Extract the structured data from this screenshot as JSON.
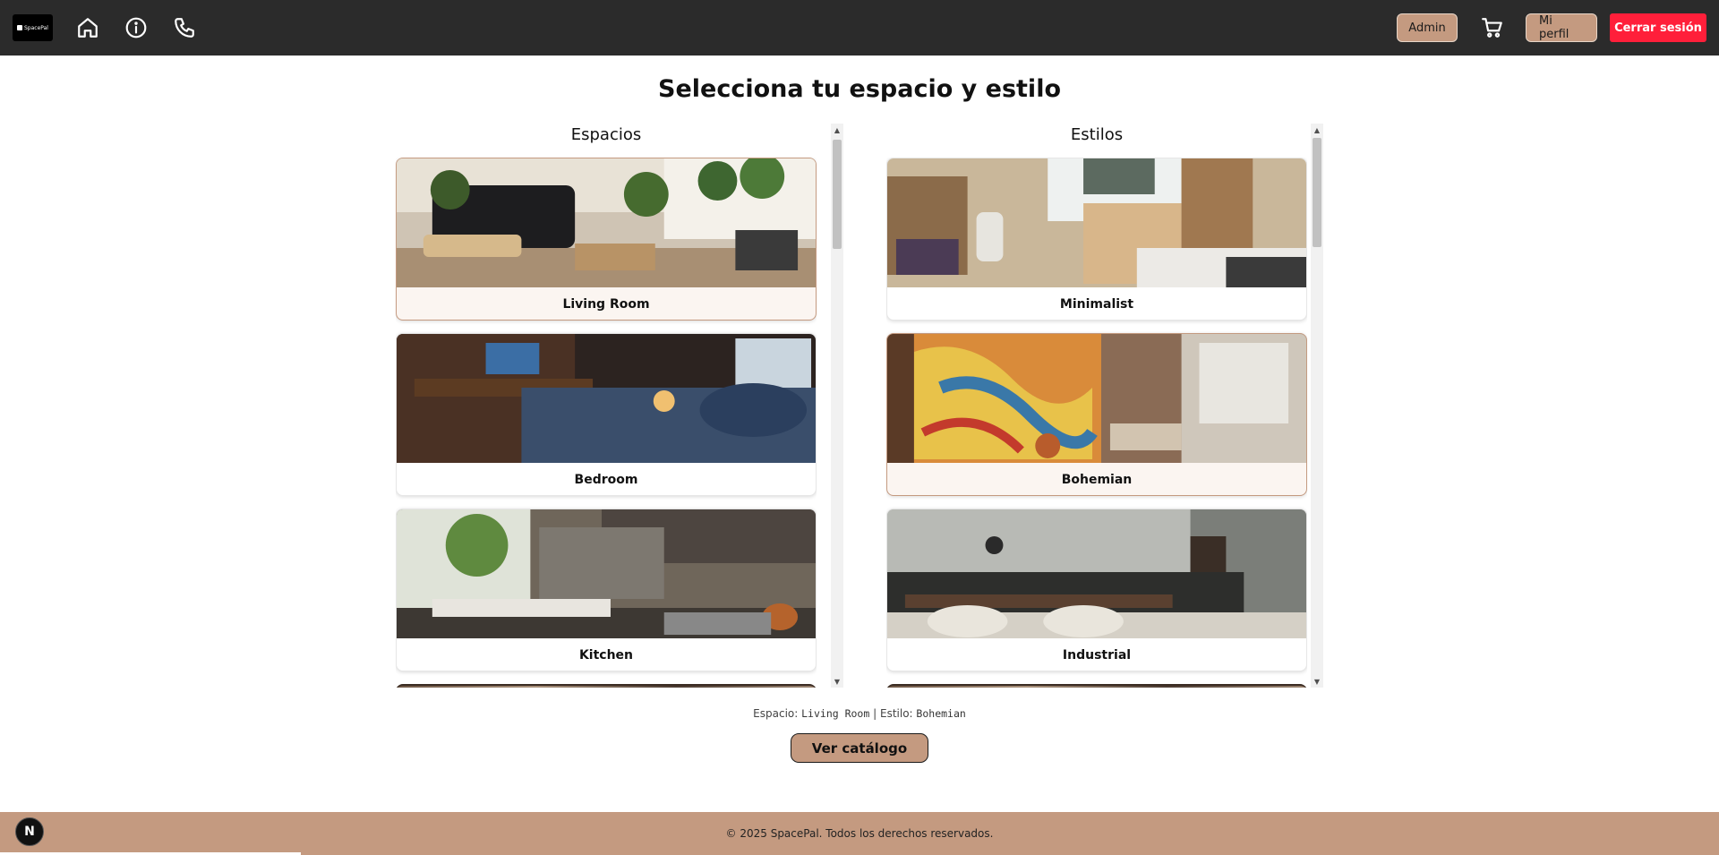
{
  "header": {
    "logo_text": "SpacePal",
    "nav_icons": [
      "home-icon",
      "info-icon",
      "phone-icon"
    ],
    "admin_label": "Admin",
    "profile_label": "Mi perfil",
    "logout_label": "Cerrar sesión",
    "colors": {
      "bar": "#2b2b2b",
      "tan": "#c49a80",
      "logout": "#ff1f3a"
    }
  },
  "main": {
    "title": "Selecciona tu espacio y estilo",
    "spaces": {
      "heading": "Espacios",
      "items": [
        {
          "label": "Living Room",
          "selected": true
        },
        {
          "label": "Bedroom",
          "selected": false
        },
        {
          "label": "Kitchen",
          "selected": false
        }
      ]
    },
    "styles": {
      "heading": "Estilos",
      "items": [
        {
          "label": "Minimalist",
          "selected": false
        },
        {
          "label": "Bohemian",
          "selected": true
        },
        {
          "label": "Industrial",
          "selected": false
        }
      ]
    },
    "selection": {
      "space_prefix": "Espacio:",
      "space_value": "Living Room",
      "separator": "|",
      "style_prefix": "Estilo:",
      "style_value": "Bohemian"
    },
    "cta_label": "Ver catálogo"
  },
  "footer": {
    "copyright": "© 2025 SpacePal. Todos los derechos reservados.",
    "badge": "N"
  }
}
